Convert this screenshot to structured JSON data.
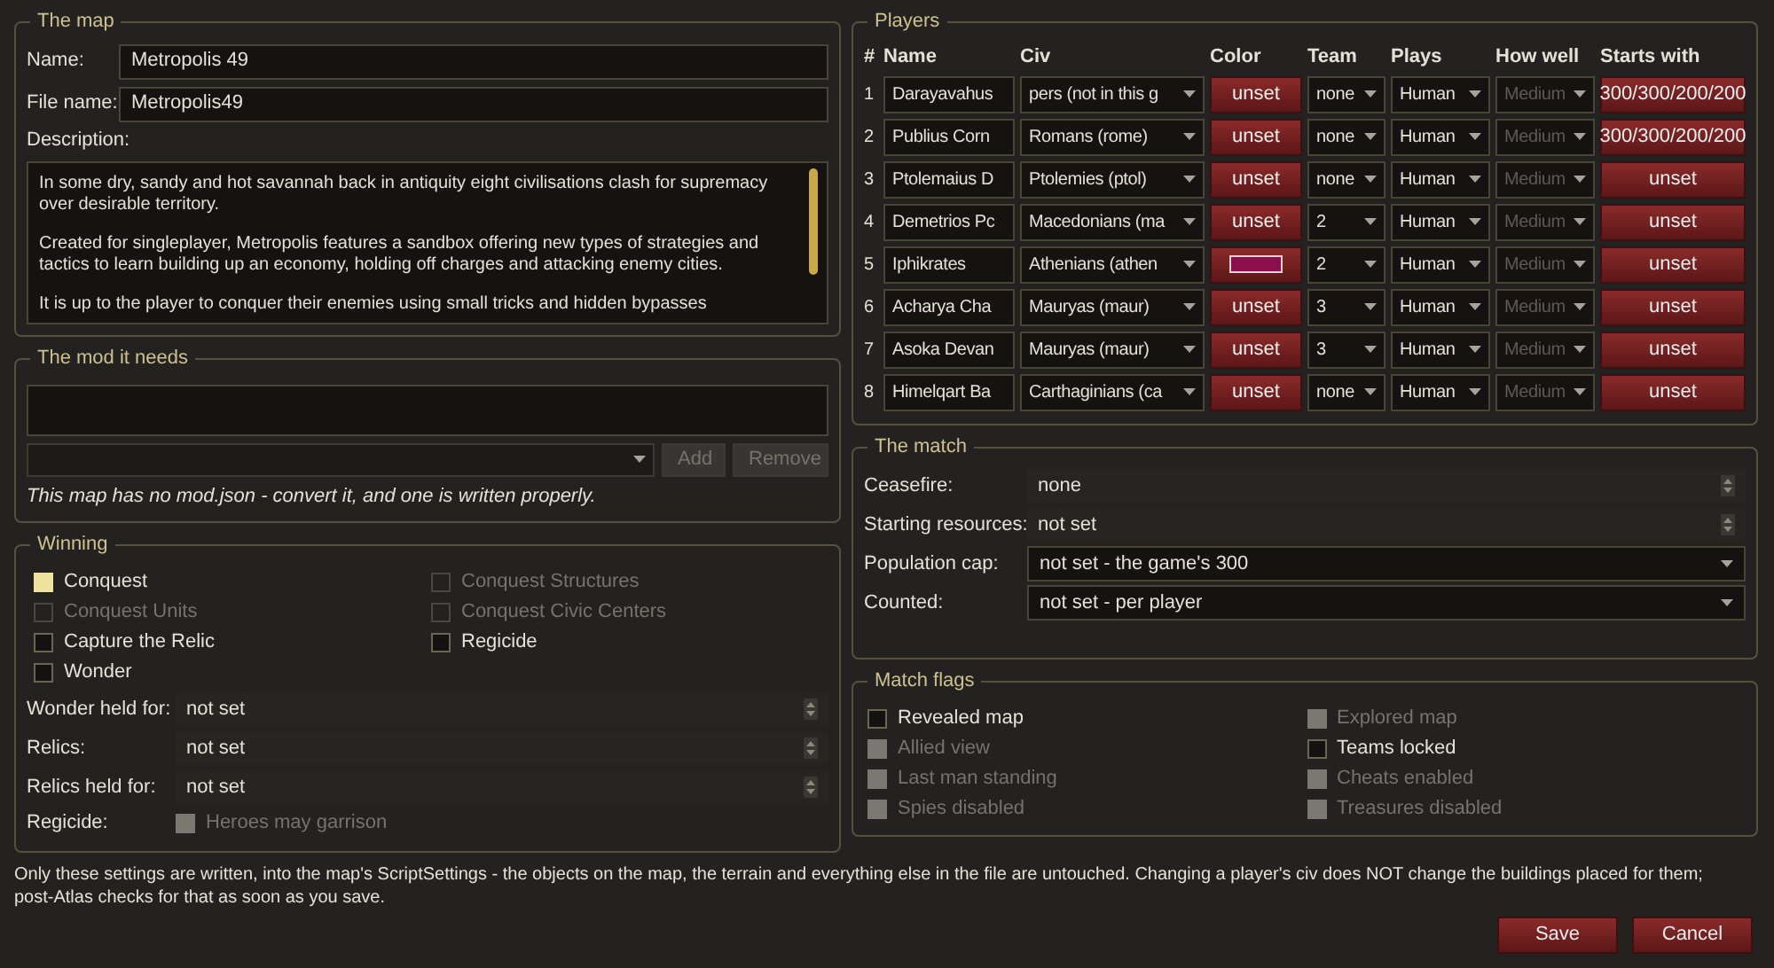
{
  "map": {
    "legend": "The map",
    "fields": [
      {
        "label": "Name:",
        "value": "Metropolis 49"
      },
      {
        "label": "File name:",
        "value": "Metropolis49"
      }
    ],
    "description_label": "Description:",
    "description": [
      "In some dry, sandy and hot savannah back in antiquity eight civilisations clash for supremacy over desirable territory.",
      "Created for singleplayer, Metropolis features a sandbox offering new types of strategies and tactics to learn building up an economy, holding off charges and attacking enemy cities.",
      "It is up to the player to conquer their enemies using small tricks and hidden bypasses"
    ]
  },
  "mod": {
    "legend": "The mod it needs",
    "add": {
      "label": "Add",
      "disabled": true
    },
    "remove": {
      "label": "Remove",
      "disabled": true
    },
    "note": "This map has no mod.json - convert it, and one is written properly."
  },
  "winning": {
    "legend": "Winning",
    "conditions": [
      {
        "label": "Conquest",
        "checked": true,
        "disabled": false
      },
      {
        "label": "Conquest Structures",
        "checked": false,
        "disabled": true
      },
      {
        "label": "Conquest Units",
        "checked": false,
        "disabled": true
      },
      {
        "label": "Conquest Civic Centers",
        "checked": false,
        "disabled": true
      },
      {
        "label": "Capture the Relic",
        "checked": false,
        "disabled": false
      },
      {
        "label": "Regicide",
        "checked": false,
        "disabled": false
      },
      {
        "label": "Wonder",
        "checked": false,
        "disabled": false
      }
    ],
    "fields": [
      {
        "kind": "spin",
        "label": "Wonder held for:",
        "value": "not set"
      },
      {
        "kind": "spin",
        "label": "Relics:",
        "value": "not set"
      },
      {
        "kind": "spin",
        "label": "Relics held for:",
        "value": "not set"
      },
      {
        "kind": "check",
        "label": "Regicide:",
        "check_label": "Heroes may garrison",
        "checked": false,
        "disabled": true
      }
    ]
  },
  "players": {
    "legend": "Players",
    "columns": [
      "#",
      "Name",
      "Civ",
      "Color",
      "Team",
      "Plays",
      "How well",
      "Starts with"
    ],
    "rows": [
      {
        "number": "1",
        "name": "Darayavahus",
        "civ": "pers (not in this g",
        "color": {
          "kind": "unset",
          "label": "unset"
        },
        "team": "none",
        "plays": "Human",
        "how_well": {
          "value": "Medium",
          "disabled": true
        },
        "starts_with": "300/300/200/200"
      },
      {
        "number": "2",
        "name": "Publius Corn",
        "civ": "Romans (rome)",
        "color": {
          "kind": "unset",
          "label": "unset"
        },
        "team": "none",
        "plays": "Human",
        "how_well": {
          "value": "Medium",
          "disabled": true
        },
        "starts_with": "300/300/200/200"
      },
      {
        "number": "3",
        "name": "Ptolemaius D",
        "civ": "Ptolemies (ptol)",
        "color": {
          "kind": "unset",
          "label": "unset"
        },
        "team": "none",
        "plays": "Human",
        "how_well": {
          "value": "Medium",
          "disabled": true
        },
        "starts_with": "unset"
      },
      {
        "number": "4",
        "name": "Demetrios Pc",
        "civ": "Macedonians (ma",
        "color": {
          "kind": "unset",
          "label": "unset"
        },
        "team": "2",
        "plays": "Human",
        "how_well": {
          "value": "Medium",
          "disabled": true
        },
        "starts_with": "unset"
      },
      {
        "number": "5",
        "name": "Iphikrates",
        "civ": "Athenians (athen",
        "color": {
          "kind": "swatch",
          "color": "#8a0f4a"
        },
        "team": "2",
        "plays": "Human",
        "how_well": {
          "value": "Medium",
          "disabled": true
        },
        "starts_with": "unset"
      },
      {
        "number": "6",
        "name": "Acharya Cha",
        "civ": "Mauryas (maur)",
        "color": {
          "kind": "unset",
          "label": "unset"
        },
        "team": "3",
        "plays": "Human",
        "how_well": {
          "value": "Medium",
          "disabled": true
        },
        "starts_with": "unset"
      },
      {
        "number": "7",
        "name": "Asoka Devan",
        "civ": "Mauryas (maur)",
        "color": {
          "kind": "unset",
          "label": "unset"
        },
        "team": "3",
        "plays": "Human",
        "how_well": {
          "value": "Medium",
          "disabled": true
        },
        "starts_with": "unset"
      },
      {
        "number": "8",
        "name": "Himelqart Ba",
        "civ": "Carthaginians (ca",
        "color": {
          "kind": "unset",
          "label": "unset"
        },
        "team": "none",
        "plays": "Human",
        "how_well": {
          "value": "Medium",
          "disabled": true
        },
        "starts_with": "unset"
      }
    ]
  },
  "match": {
    "legend": "The match",
    "fields": [
      {
        "kind": "spin",
        "label": "Ceasefire:",
        "value": "none"
      },
      {
        "kind": "spin",
        "label": "Starting resources:",
        "value": "not set"
      },
      {
        "kind": "select",
        "label": "Population cap:",
        "value": "not set - the game's 300"
      },
      {
        "kind": "select",
        "label": "Counted:",
        "value": "not set - per player"
      }
    ]
  },
  "flags": {
    "legend": "Match flags",
    "items": [
      {
        "label": "Revealed map",
        "checked": false,
        "disabled": false
      },
      {
        "label": "Explored map",
        "checked": false,
        "disabled": true
      },
      {
        "label": "Allied view",
        "checked": false,
        "disabled": true
      },
      {
        "label": "Teams locked",
        "checked": false,
        "disabled": false
      },
      {
        "label": "Last man standing",
        "checked": false,
        "disabled": true
      },
      {
        "label": "Cheats enabled",
        "checked": false,
        "disabled": true
      },
      {
        "label": "Spies disabled",
        "checked": false,
        "disabled": true
      },
      {
        "label": "Treasures disabled",
        "checked": false,
        "disabled": true
      }
    ]
  },
  "footer_note": "Only these settings are written, into the map's ScriptSettings - the objects on the map, the terrain and everything else in the file are untouched. Changing a player's civ does NOT change the buildings placed for them; post-Atlas checks for that as soon as you save.",
  "buttons": [
    "Save",
    "Cancel"
  ]
}
